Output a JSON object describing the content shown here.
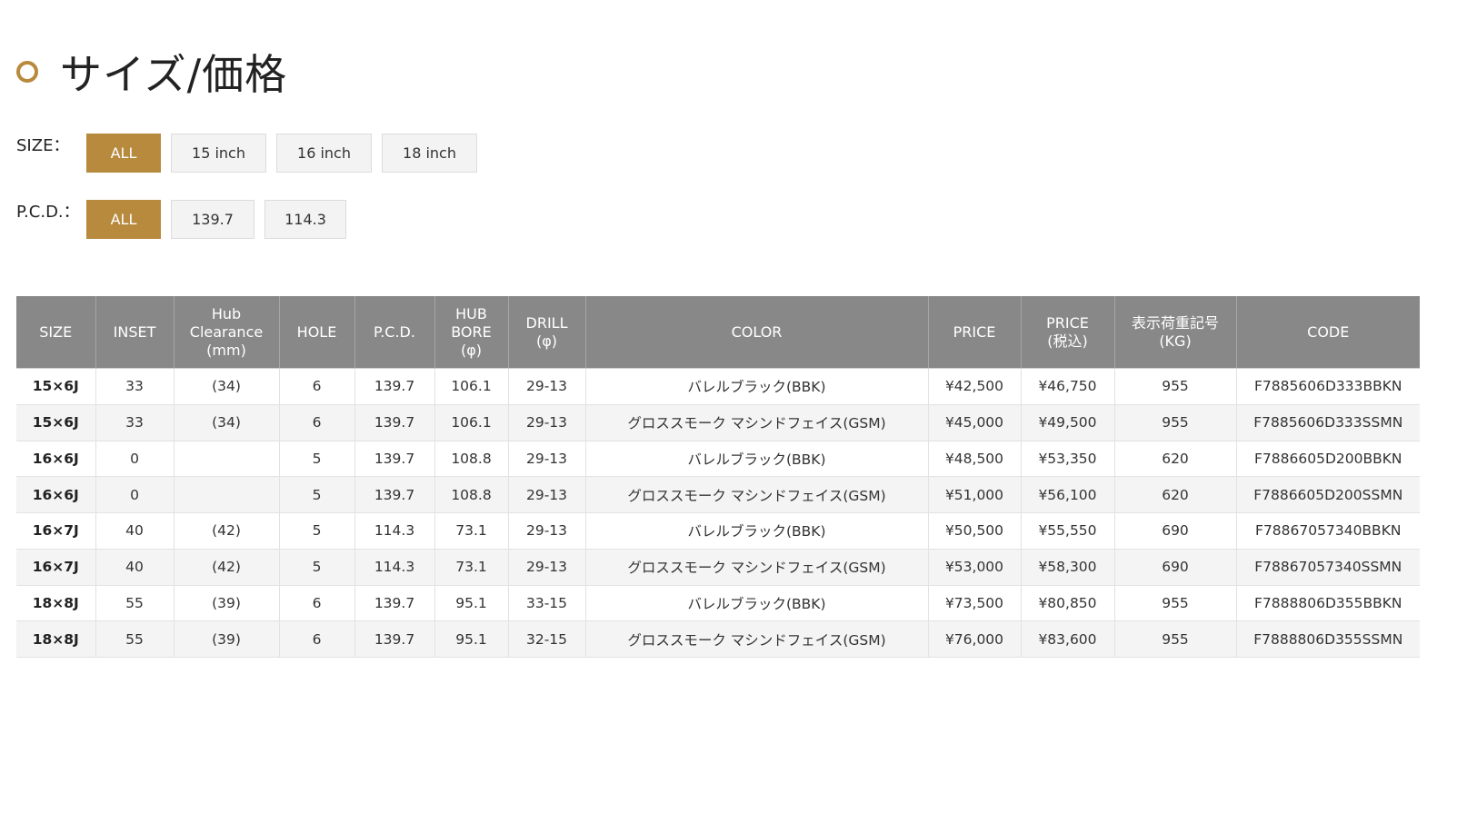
{
  "heading": {
    "title": "サイズ/価格"
  },
  "filters": {
    "size": {
      "label": "SIZE：",
      "options": [
        "ALL",
        "15 inch",
        "16 inch",
        "18 inch"
      ],
      "selected": "ALL"
    },
    "pcd": {
      "label": "P.C.D.：",
      "options": [
        "ALL",
        "139.7",
        "114.3"
      ],
      "selected": "ALL"
    }
  },
  "table": {
    "headers": [
      "SIZE",
      "INSET",
      "Hub\nClearance\n(mm)",
      "HOLE",
      "P.C.D.",
      "HUB\nBORE\n(φ)",
      "DRILL\n(φ)",
      "COLOR",
      "PRICE",
      "PRICE\n(税込)",
      "表示荷重記号\n(KG)",
      "CODE"
    ],
    "rows": [
      [
        "15×6J",
        "33",
        "(34)",
        "6",
        "139.7",
        "106.1",
        "29-13",
        "バレルブラック(BBK)",
        "¥42,500",
        "¥46,750",
        "955",
        "F7885606D333BBKN"
      ],
      [
        "15×6J",
        "33",
        "(34)",
        "6",
        "139.7",
        "106.1",
        "29-13",
        "グロススモーク マシンドフェイス(GSM)",
        "¥45,000",
        "¥49,500",
        "955",
        "F7885606D333SSMN"
      ],
      [
        "16×6J",
        "0",
        "",
        "5",
        "139.7",
        "108.8",
        "29-13",
        "バレルブラック(BBK)",
        "¥48,500",
        "¥53,350",
        "620",
        "F7886605D200BBKN"
      ],
      [
        "16×6J",
        "0",
        "",
        "5",
        "139.7",
        "108.8",
        "29-13",
        "グロススモーク マシンドフェイス(GSM)",
        "¥51,000",
        "¥56,100",
        "620",
        "F7886605D200SSMN"
      ],
      [
        "16×7J",
        "40",
        "(42)",
        "5",
        "114.3",
        "73.1",
        "29-13",
        "バレルブラック(BBK)",
        "¥50,500",
        "¥55,550",
        "690",
        "F78867057340BBKN"
      ],
      [
        "16×7J",
        "40",
        "(42)",
        "5",
        "114.3",
        "73.1",
        "29-13",
        "グロススモーク マシンドフェイス(GSM)",
        "¥53,000",
        "¥58,300",
        "690",
        "F78867057340SSMN"
      ],
      [
        "18×8J",
        "55",
        "(39)",
        "6",
        "139.7",
        "95.1",
        "33-15",
        "バレルブラック(BBK)",
        "¥73,500",
        "¥80,850",
        "955",
        "F7888806D355BBKN"
      ],
      [
        "18×8J",
        "55",
        "(39)",
        "6",
        "139.7",
        "95.1",
        "32-15",
        "グロススモーク マシンドフェイス(GSM)",
        "¥76,000",
        "¥83,600",
        "955",
        "F7888806D355SSMN"
      ]
    ]
  },
  "colors": {
    "accent": "#b88a3e",
    "header_bg": "#888888",
    "row_alt": "#f4f4f4",
    "button_bg": "#f3f3f3"
  },
  "icons": {
    "heading": "ring-bullet-icon"
  }
}
